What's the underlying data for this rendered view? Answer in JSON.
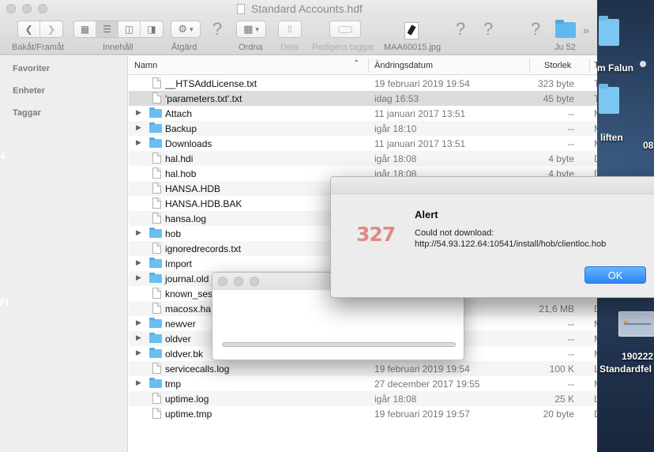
{
  "window": {
    "title": "Standard Accounts.hdf"
  },
  "toolbar": {
    "nav_label": "Bakåt/Framåt",
    "view_label": "Innehåll",
    "action_label": "Åtgärd",
    "arrange_label": "Ordna",
    "share_label": "Dela",
    "tags_label": "Redigera taggar",
    "file_label": "MAA60015.jpg",
    "folder_label": "Ju 52",
    "back_icon": "chevron-left-icon",
    "forward_icon": "chevron-right-icon"
  },
  "sidebar": {
    "sections": [
      "Favoriter",
      "Enheter",
      "Taggar"
    ]
  },
  "columns": {
    "name": "Namn",
    "date": "Ändringsdatum",
    "size": "Storlek",
    "kind": "Ty"
  },
  "files": [
    {
      "name": "__HTSAddLicense.txt",
      "date": "19 februari 2019 19:54",
      "size": "323 byte",
      "kind": "T",
      "type": "file"
    },
    {
      "name": "'parameters.txt'.txt",
      "date": "idag 16:53",
      "size": "45 byte",
      "kind": "T",
      "type": "file",
      "selected": true
    },
    {
      "name": "Attach",
      "date": "11 januari 2017 13:51",
      "size": "--",
      "kind": "M",
      "type": "folder"
    },
    {
      "name": "Backup",
      "date": "igår 18:10",
      "size": "--",
      "kind": "M",
      "type": "folder"
    },
    {
      "name": "Downloads",
      "date": "11 januari 2017 13:51",
      "size": "--",
      "kind": "M",
      "type": "folder"
    },
    {
      "name": "hal.hdi",
      "date": "igår 18:08",
      "size": "4 byte",
      "kind": "D",
      "type": "file"
    },
    {
      "name": "hal.hob",
      "date": "igår 18:08",
      "size": "4 byte",
      "kind": "D",
      "type": "file"
    },
    {
      "name": "HANSA.HDB",
      "date": "",
      "size": "",
      "kind": "",
      "type": "file"
    },
    {
      "name": "HANSA.HDB.BAK",
      "date": "",
      "size": "",
      "kind": "",
      "type": "file"
    },
    {
      "name": "hansa.log",
      "date": "",
      "size": "",
      "kind": "",
      "type": "file"
    },
    {
      "name": "hob",
      "date": "",
      "size": "",
      "kind": "",
      "type": "folder"
    },
    {
      "name": "ignoredrecords.txt",
      "date": "",
      "size": "",
      "kind": "",
      "type": "file"
    },
    {
      "name": "Import",
      "date": "",
      "size": "",
      "kind": "",
      "type": "folder"
    },
    {
      "name": "journal.old",
      "date": "",
      "size": "",
      "kind": "",
      "type": "folder"
    },
    {
      "name": "known_ses",
      "date": "",
      "size": "",
      "kind": "",
      "type": "file"
    },
    {
      "name": "macosx.ha",
      "date": "19:55",
      "size": "21,6 MB",
      "kind": "D",
      "type": "file"
    },
    {
      "name": "newver",
      "date": "19:55",
      "size": "--",
      "kind": "M",
      "type": "folder"
    },
    {
      "name": "oldver",
      "date": "19:55",
      "size": "--",
      "kind": "M",
      "type": "folder"
    },
    {
      "name": "oldver.bk",
      "date": "5",
      "size": "--",
      "kind": "M",
      "type": "folder"
    },
    {
      "name": "servicecalls.log",
      "date": "19 februari 2019 19:54",
      "size": "100 K",
      "kind": "L",
      "type": "file"
    },
    {
      "name": "tmp",
      "date": "27 december 2017 19:55",
      "size": "--",
      "kind": "M",
      "type": "folder"
    },
    {
      "name": "uptime.log",
      "date": "igår 18:08",
      "size": "25 K",
      "kind": "L",
      "type": "file"
    },
    {
      "name": "uptime.tmp",
      "date": "19 februari 2019 19:57",
      "size": "20 byte",
      "kind": "D",
      "type": "file"
    }
  ],
  "progress": {
    "fraction": 0.0
  },
  "alert": {
    "title": "Alert",
    "icon_text": "327",
    "message": "Could not download: http://54.93.122.64:10541/install/hob/clientloc.hob",
    "ok_label": "OK"
  },
  "desktop": {
    "labels": [
      "m Falun",
      "liften",
      "08",
      "190222",
      "Standardfel"
    ],
    "edge_marks": [
      "4",
      "FI"
    ]
  },
  "colors": {
    "accent": "#2a86f4",
    "folder": "#68bff0",
    "alert_icon": "#e08888"
  }
}
